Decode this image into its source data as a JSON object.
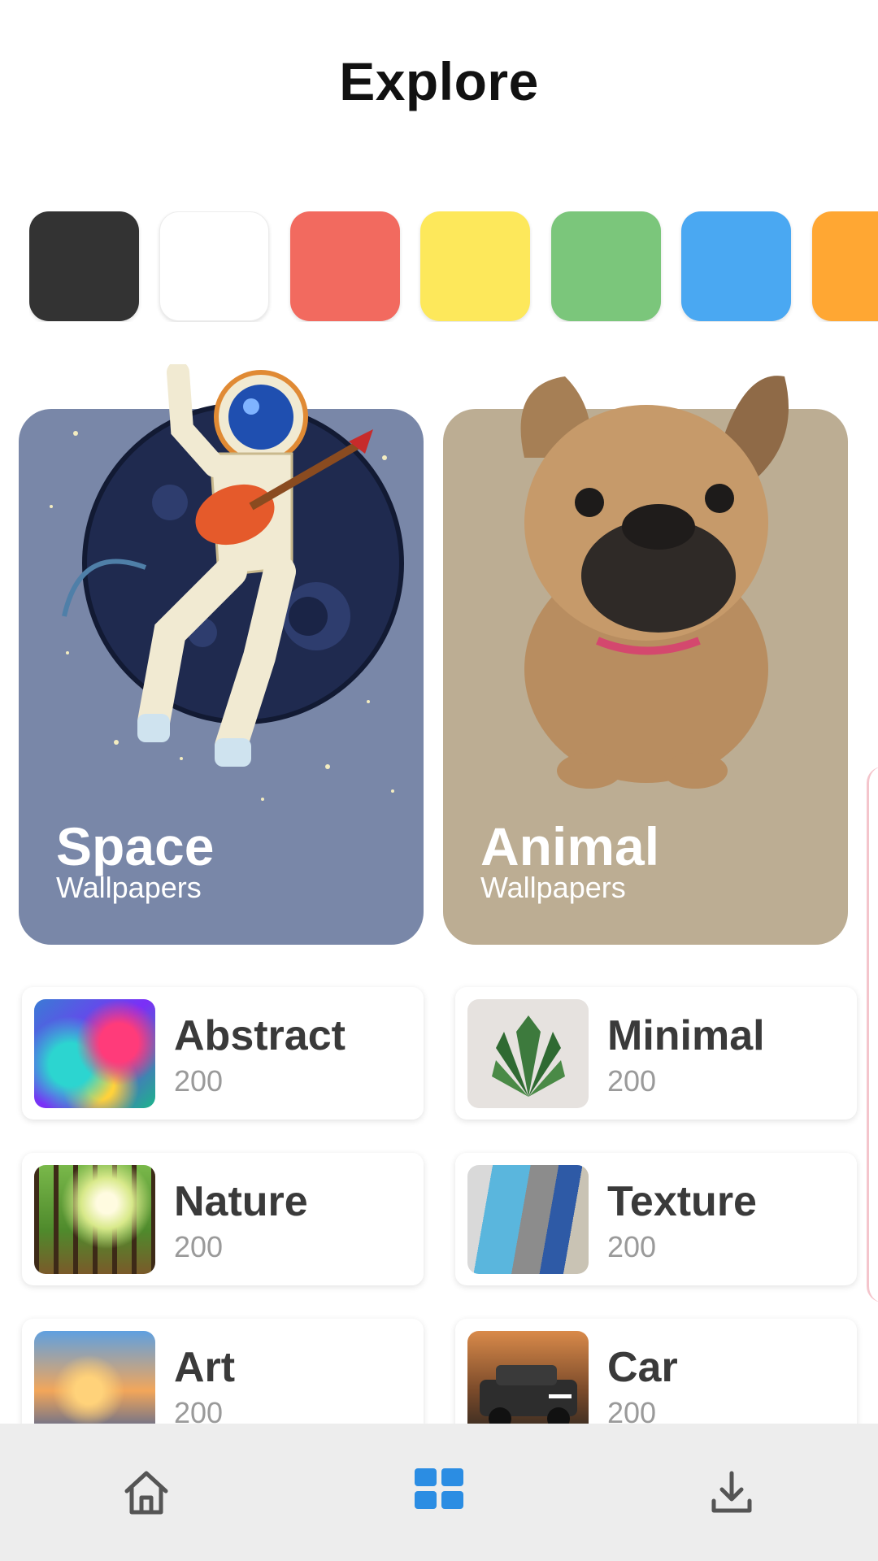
{
  "header": {
    "title": "Explore"
  },
  "colors": {
    "chips": [
      "#333333",
      "#ffffff",
      "#f26a5f",
      "#fde85b",
      "#7bc67b",
      "#4aa8f2",
      "#ffa733"
    ],
    "space_bg": "#7987a8",
    "animal_bg": "#bcad93",
    "accent": "#2b8de3",
    "nav_bg": "#ededed"
  },
  "featured": [
    {
      "title": "Space",
      "subtitle": "Wallpapers"
    },
    {
      "title": "Animal",
      "subtitle": "Wallpapers"
    }
  ],
  "categories": [
    {
      "name": "Abstract",
      "count": "200"
    },
    {
      "name": "Minimal",
      "count": "200"
    },
    {
      "name": "Nature",
      "count": "200"
    },
    {
      "name": "Texture",
      "count": "200"
    },
    {
      "name": "Art",
      "count": "200"
    },
    {
      "name": "Car",
      "count": "200"
    }
  ],
  "nav": {
    "items": [
      {
        "icon": "home-icon",
        "active": false
      },
      {
        "icon": "grid-icon",
        "active": true
      },
      {
        "icon": "download-icon",
        "active": false
      }
    ]
  }
}
